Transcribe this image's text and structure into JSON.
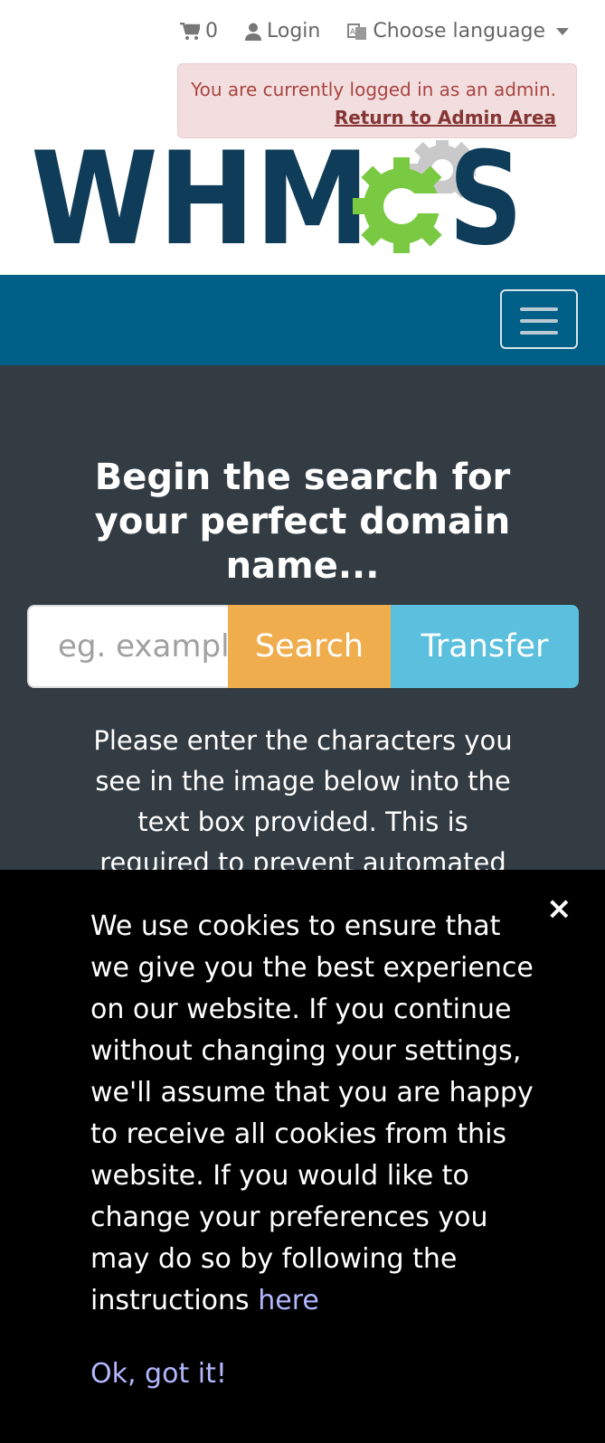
{
  "topbar": {
    "cart_count": "0",
    "login_label": "Login",
    "language_label": "Choose language"
  },
  "admin_alert": {
    "message": "You are currently logged in as an admin.",
    "link": "Return to Admin Area"
  },
  "logo": {
    "text": "WHMCS",
    "text_color": "#0e3c59",
    "gear_green": "#7ac943",
    "gear_grey": "#c9c9c9"
  },
  "navbar": {
    "color": "#005f86"
  },
  "hero": {
    "heading_lines": [
      "Begin the search for",
      "your perfect domain",
      "name..."
    ],
    "search_placeholder": "eg. example.com",
    "search_button": "Search",
    "transfer_button": "Transfer",
    "captcha_text": "Please enter the characters you see in the image below into the text box provided. This is required to prevent automated"
  },
  "cookie": {
    "close": "×",
    "message": "We use cookies to ensure that we give you the best experience on our website. If you continue without changing your settings, we'll assume that you are happy to receive all cookies from this website. If you would like to change your preferences you may do so by following the instructions",
    "link": "here",
    "ok": "Ok, got it!"
  }
}
